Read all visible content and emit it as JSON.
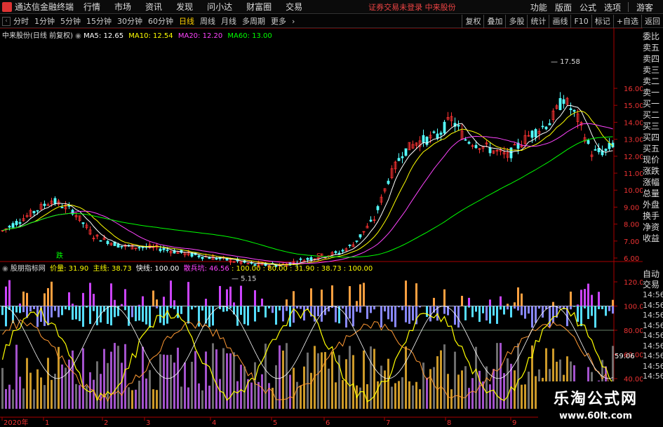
{
  "menubar": {
    "app_title": "通达信金融终端",
    "menus": [
      "行情",
      "市场",
      "资讯",
      "发现",
      "问小达",
      "财富圈",
      "交易"
    ],
    "status": "证券交易未登录  中来股份",
    "right": [
      "功能",
      "版面",
      "公式",
      "选项"
    ],
    "user": "游客"
  },
  "toolbar": {
    "periods": [
      "分时",
      "1分钟",
      "5分钟",
      "15分钟",
      "30分钟",
      "60分钟",
      "日线",
      "周线",
      "月线",
      "多周期",
      "更多"
    ],
    "active": "日线",
    "right_buttons": [
      "复权",
      "叠加",
      "多股",
      "统计",
      "画线",
      "F10",
      "标记",
      "+自选",
      "返回"
    ]
  },
  "main_chart": {
    "title": "中来股份(日线 前复权)",
    "ma5": "MA5: 12.65",
    "ma10": "MA10: 12.54",
    "ma20": "MA20: 12.20",
    "ma60": "MA60: 13.00",
    "high_label": "17.58",
    "low_label": "5.15",
    "sell_marker": "跌",
    "buy_marker": "S",
    "y_ticks": [
      "16.00",
      "15.00",
      "14.00",
      "13.00",
      "12.00",
      "11.00",
      "10.00",
      "9.00",
      "8.00",
      "7.00",
      "6.00"
    ],
    "colors": {
      "ma5": "#ffffff",
      "ma10": "#ffff00",
      "ma20": "#ff44ff",
      "ma60": "#00ff00",
      "up": "#ff3333",
      "down": "#54ffff"
    }
  },
  "indicator": {
    "name": "股朋指标网",
    "price_label": "价量: 31.90",
    "main_label": "主线: 38.73",
    "fast_label": "快线: 100.00",
    "retail_label": "散兵坑: 46.56",
    "extra": ": 100.00  : 80.00  : 31.90  : 38.73  : 100.00",
    "y_ticks": [
      "120.00",
      "100.00",
      "80.00",
      "60.00",
      "40.00"
    ],
    "current_value": "59.06"
  },
  "x_axis": [
    "2020年",
    "1",
    "2",
    "3",
    "4",
    "5",
    "6",
    "7",
    "8",
    "9"
  ],
  "right_panel": {
    "items": [
      "委比",
      "卖五",
      "卖四",
      "卖三",
      "卖二",
      "卖一",
      "买一",
      "买二",
      "买三",
      "买四",
      "买五",
      "现价",
      "涨跌",
      "涨幅",
      "总量",
      "外盘",
      "换手",
      "净资",
      "收益"
    ],
    "lower_header": [
      "自动",
      "交易"
    ],
    "times": [
      "14:56",
      "14:56",
      "14:56",
      "14:56",
      "14:56",
      "14:56",
      "14:56",
      "14:56",
      "14:56",
      "14:56"
    ]
  },
  "watermark": {
    "cn": "乐淘公式网",
    "url": "www.60lt.com"
  }
}
